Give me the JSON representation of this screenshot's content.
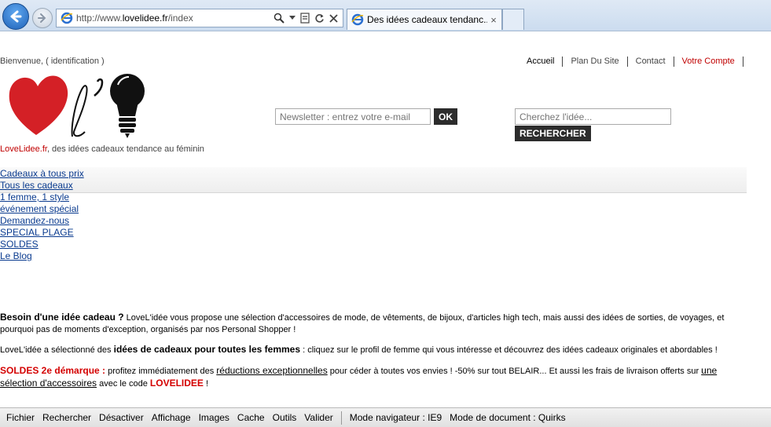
{
  "browser": {
    "url_prefix": "http://www.",
    "url_domain": "lovelidee.fr",
    "url_path": "/index",
    "tab_title": "Des idées cadeaux tendanc...",
    "tab_close": "×"
  },
  "header": {
    "welcome": "Bienvenue, ( identification )",
    "topnav": [
      "Accueil",
      "Plan Du Site",
      "Contact",
      "Votre Compte"
    ],
    "tagline_brand": "LoveLidee.fr",
    "tagline_rest": ", des idées cadeaux tendance au féminin"
  },
  "newsletter": {
    "placeholder": "Newsletter : entrez votre e-mail",
    "button": "OK"
  },
  "search": {
    "placeholder": "Cherchez l'idée...",
    "button": "RECHERCHER"
  },
  "menu": [
    "Cadeaux à tous prix",
    "Tous les cadeaux",
    "1 femme, 1 style",
    "événement spécial",
    "Demandez-nous",
    "SPECIAL PLAGE",
    "SOLDES",
    "Le Blog"
  ],
  "content": {
    "p1_strong": "Besoin d'une idée cadeau ?",
    "p1_text": " LoveL'idée vous propose une sélection d'accessoires de mode, de vêtements, de bijoux, d'articles high tech, mais aussi des idées de sorties, de voyages, et pourquoi pas de moments d'exception, organisés par nos Personal Shopper !",
    "p2_a": "LoveL'idée a sélectionné des ",
    "p2_strong": "idées de cadeaux pour toutes les femmes",
    "p2_b": " : cliquez sur le profil de femme qui vous intéresse et découvrez des idées cadeaux originales et abordables !",
    "p3_red": "SOLDES 2e démarque :",
    "p3_a": " profitez immédiatement des ",
    "p3_link1": "réductions exceptionnelles",
    "p3_b": " pour céder à toutes vos envies ! -50% sur tout BELAIR... Et aussi les frais de livraison offerts sur ",
    "p3_link2": "une sélection d'accessoires",
    "p3_c": " avec le code ",
    "p3_code": "LOVELIDEE",
    "p3_d": " !"
  },
  "devtools": {
    "items": [
      "Fichier",
      "Rechercher",
      "Désactiver",
      "Affichage",
      "Images",
      "Cache",
      "Outils",
      "Valider"
    ],
    "browser_mode": "Mode navigateur : IE9",
    "document_mode": "Mode de document : Quirks"
  },
  "colors": {
    "accent_red": "#c00000",
    "button_dark": "#2c2c2c",
    "link_blue": "#0a3b8f"
  }
}
